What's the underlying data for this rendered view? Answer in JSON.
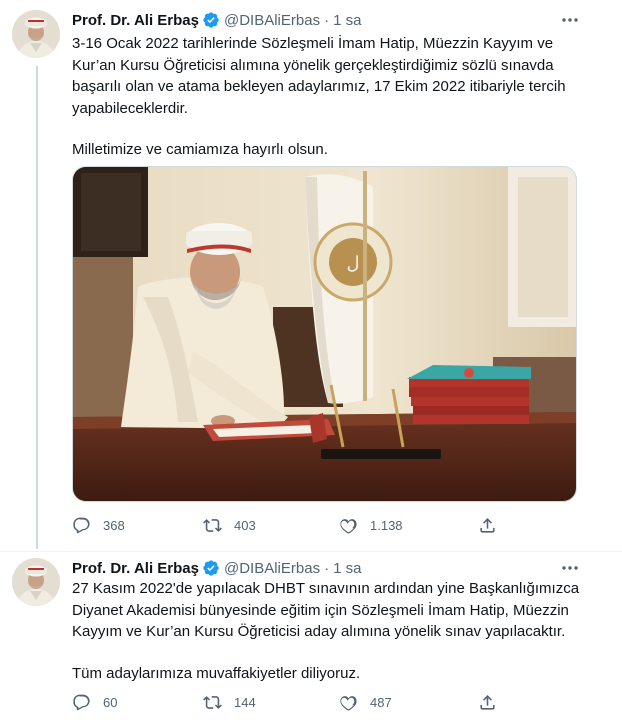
{
  "tweets": [
    {
      "author_name": "Prof. Dr. Ali Erbaş",
      "handle": "@DIBAliErbas",
      "separator": "·",
      "time": "1 sa",
      "text_lines": [
        "3-16 Ocak 2022 tarihlerinde Sözleşmeli İmam Hatip, Müezzin Kayyım ve",
        "Kur’an Kursu Öğreticisi alımına yönelik gerçekleştirdiğimiz sözlü sınavda",
        "başarılı olan ve atama bekleyen adaylarımız, 17 Ekim 2022 itibariyle tercih",
        "yapabileceklerdir."
      ],
      "text_line_extra": "Milletimize ve camiamıza hayırlı olsun.",
      "replies": "368",
      "retweets": "403",
      "likes": "1.138"
    },
    {
      "author_name": "Prof. Dr. Ali Erbaş",
      "handle": "@DIBAliErbas",
      "separator": "·",
      "time": "1 sa",
      "text_lines": [
        "27 Kasım 2022'de yapılacak DHBT sınavının ardından yine Başkanlığımızca",
        "Diyanet Akademisi bünyesinde eğitim için Sözleşmeli İmam Hatip, Müezzin",
        "Kayyım ve Kur’an Kursu Öğreticisi aday alımına yönelik sınav yapılacaktır."
      ],
      "text_line_extra": "Tüm adaylarımıza muvaffakiyetler diliyoruz.",
      "replies": "60",
      "retweets": "144",
      "likes": "487"
    }
  ],
  "colors": {
    "text": "#0f1419",
    "muted": "#536471",
    "verified": "#1d9bf0",
    "border": "#cfd9de"
  },
  "icons": {
    "verified": "verified-badge-icon",
    "more": "more-dots-icon",
    "reply": "reply-icon",
    "retweet": "retweet-icon",
    "like": "heart-icon",
    "share": "share-icon"
  }
}
